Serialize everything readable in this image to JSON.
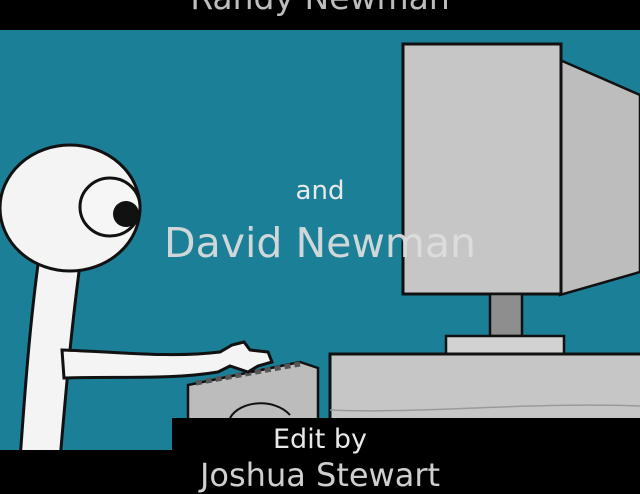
{
  "credits": {
    "top_line": "Randy Newman",
    "and": "and",
    "name": "David Newman",
    "edit_by": "Edit by",
    "bottom_line": "Joshua Stewart"
  },
  "colors": {
    "backdrop": "#1a7f97",
    "letterbox": "#000000",
    "computer_gray": "#c6c6c6",
    "character_white": "#f4f4f4",
    "outline": "#111111"
  }
}
